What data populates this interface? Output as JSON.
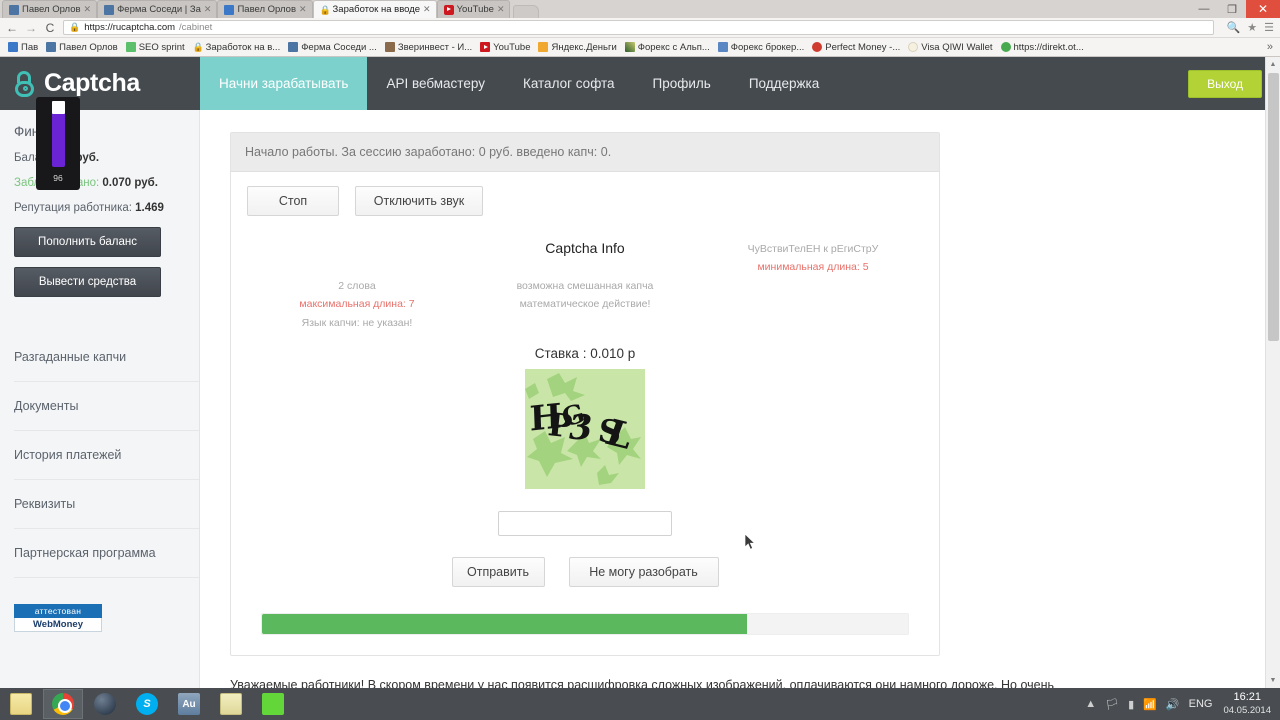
{
  "browser": {
    "tabs": [
      {
        "title": "Павел Орлов",
        "icon": "vk-icon",
        "active": false
      },
      {
        "title": "Ферма Соседи | За",
        "icon": "vk-icon",
        "active": false
      },
      {
        "title": "Павел Орлов",
        "icon": "blue-square-icon",
        "active": false
      },
      {
        "title": "Заработок на вводе",
        "icon": "lock-icon",
        "active": true
      },
      {
        "title": "YouTube",
        "icon": "youtube-icon",
        "active": false
      }
    ],
    "newtab_label": "",
    "window_controls": {
      "minimize": "—",
      "maximize": "❐",
      "close": "✕"
    },
    "nav": {
      "back": "←",
      "forward": "→",
      "reload": "C"
    },
    "url": {
      "lock": "🔒",
      "domain": "https://rucaptcha.com",
      "path": "/cabinet"
    },
    "omnibox_actions": {
      "search": "🔍",
      "bookmark_star": "★",
      "menu": "☰"
    },
    "bookmarks": [
      {
        "label": "Пав",
        "icon": "blue-square-icon"
      },
      {
        "label": "Павел Орлов",
        "icon": "vk-icon"
      },
      {
        "label": "SEO sprint",
        "icon": "green-s-icon"
      },
      {
        "label": "Заработок на в...",
        "icon": "lock-icon"
      },
      {
        "label": "Ферма Соседи ...",
        "icon": "vk-icon"
      },
      {
        "label": "Зверинвест - И...",
        "icon": "photo-icon"
      },
      {
        "label": "YouTube",
        "icon": "youtube-icon"
      },
      {
        "label": "Яндекс.Деньги",
        "icon": "orange-icon"
      },
      {
        "label": "Форекс с Альп...",
        "icon": "chart-icon"
      },
      {
        "label": "Форекс брокер...",
        "icon": "mountain-icon"
      },
      {
        "label": "Perfect Money -...",
        "icon": "red-circle-icon"
      },
      {
        "label": "Visa QIWI Wallet",
        "icon": "qiwi-icon"
      },
      {
        "label": "https://direkt.ot...",
        "icon": "green-circle-icon"
      }
    ],
    "bookmarks_overflow": "»"
  },
  "site": {
    "brand": "Captcha",
    "nav_items": [
      {
        "label": "Начни зарабатывать",
        "active": true
      },
      {
        "label": "API вебмастеру",
        "active": false
      },
      {
        "label": "Каталог софта",
        "active": false
      },
      {
        "label": "Профиль",
        "active": false
      },
      {
        "label": "Поддержка",
        "active": false
      }
    ],
    "logout_label": "Выход"
  },
  "sidebar": {
    "heading": "Финансы",
    "balance_label": "Баланс: ",
    "balance_value": "21 руб.",
    "blocked_label": "Заблокировано: ",
    "blocked_value": "0.070 руб.",
    "reputation_label": "Репутация работника: ",
    "reputation_value": "1.469",
    "deposit_button": "Пополнить баланс",
    "withdraw_button": "Вывести средства",
    "nav": [
      {
        "label": "Разгаданные капчи"
      },
      {
        "label": "Документы"
      },
      {
        "label": "История платежей"
      },
      {
        "label": "Реквизиты"
      },
      {
        "label": "Партнерская программа"
      }
    ],
    "webmoney_badge_top": "аттестован",
    "webmoney_badge_bottom": "WebMoney"
  },
  "work": {
    "status_line": "Начало работы. За сессию заработано: 0 руб. введено капч: 0.",
    "stop_button": "Стоп",
    "mute_button": "Отключить звук",
    "captcha_info_title": "Captcha Info",
    "info_left": [
      {
        "text": "ЧуВствиТелЕН к рЕгиСтрУ",
        "red": false
      },
      {
        "text": "минимальная длина: 5",
        "red": true
      }
    ],
    "info_center": [
      {
        "text": "2 слова",
        "red": false
      },
      {
        "text": "максимальная длина: 7",
        "red": true
      },
      {
        "text": "Язык капчи: не указан!",
        "red": false
      }
    ],
    "info_right": [
      {
        "text": "возможна смешанная капча",
        "red": false
      },
      {
        "text": "математическое действие!",
        "red": false
      }
    ],
    "stake_text": "Ставка : 0.010 р",
    "captcha_text": "HPG3SL",
    "answer_value": "",
    "answer_placeholder": "",
    "send_button": "Отправить",
    "cant_read_button": "Не могу разобрать",
    "progress_percent": 75,
    "progress_color": "#5cb85c"
  },
  "notice": "Уважаемые работники! В скором времени у нас появится расшифровка сложных изображений, оплачиваются они намного дороже. Но очень",
  "volume_overlay": {
    "value": "96",
    "color": "#6b23d6"
  },
  "taskbar": {
    "buttons": [
      {
        "name": "explorer",
        "icon": "folder-icon",
        "active": false
      },
      {
        "name": "chrome",
        "icon": "chrome-icon",
        "active": true
      },
      {
        "name": "media-player",
        "icon": "media-icon",
        "active": false
      },
      {
        "name": "skype",
        "icon": "skype-icon",
        "active": false,
        "glyph": "S"
      },
      {
        "name": "audition",
        "icon": "au-icon",
        "active": false,
        "glyph": "Au"
      },
      {
        "name": "notes",
        "icon": "note-icon",
        "active": false
      },
      {
        "name": "app-green",
        "icon": "green-app-icon",
        "active": false
      }
    ],
    "tray": [
      "▲",
      "🏳",
      "▮",
      "📶",
      "🔊"
    ],
    "language": "ENG",
    "time": "16:21",
    "date": "04.05.2014"
  }
}
